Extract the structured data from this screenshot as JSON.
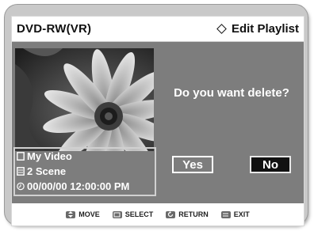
{
  "header": {
    "left_title": "DVD-RW(VR)",
    "right_title": "Edit Playlist",
    "right_icon": "diamond-icon"
  },
  "info": {
    "title": "My Video",
    "scenes": "2 Scene",
    "datetime": "00/00/00 12:00:00  PM"
  },
  "dialog": {
    "question": "Do you want delete?",
    "yes_label": "Yes",
    "no_label": "No",
    "selected": "No"
  },
  "footer": {
    "items": [
      {
        "icon": "updown-key-icon",
        "label": "MOVE"
      },
      {
        "icon": "enter-key-icon",
        "label": "SELECT"
      },
      {
        "icon": "return-key-icon",
        "label": "RETURN"
      },
      {
        "icon": "menu-key-icon",
        "label": "EXIT"
      }
    ]
  },
  "colors": {
    "panel": "#7d7d7d",
    "selected_button": "#111111"
  }
}
